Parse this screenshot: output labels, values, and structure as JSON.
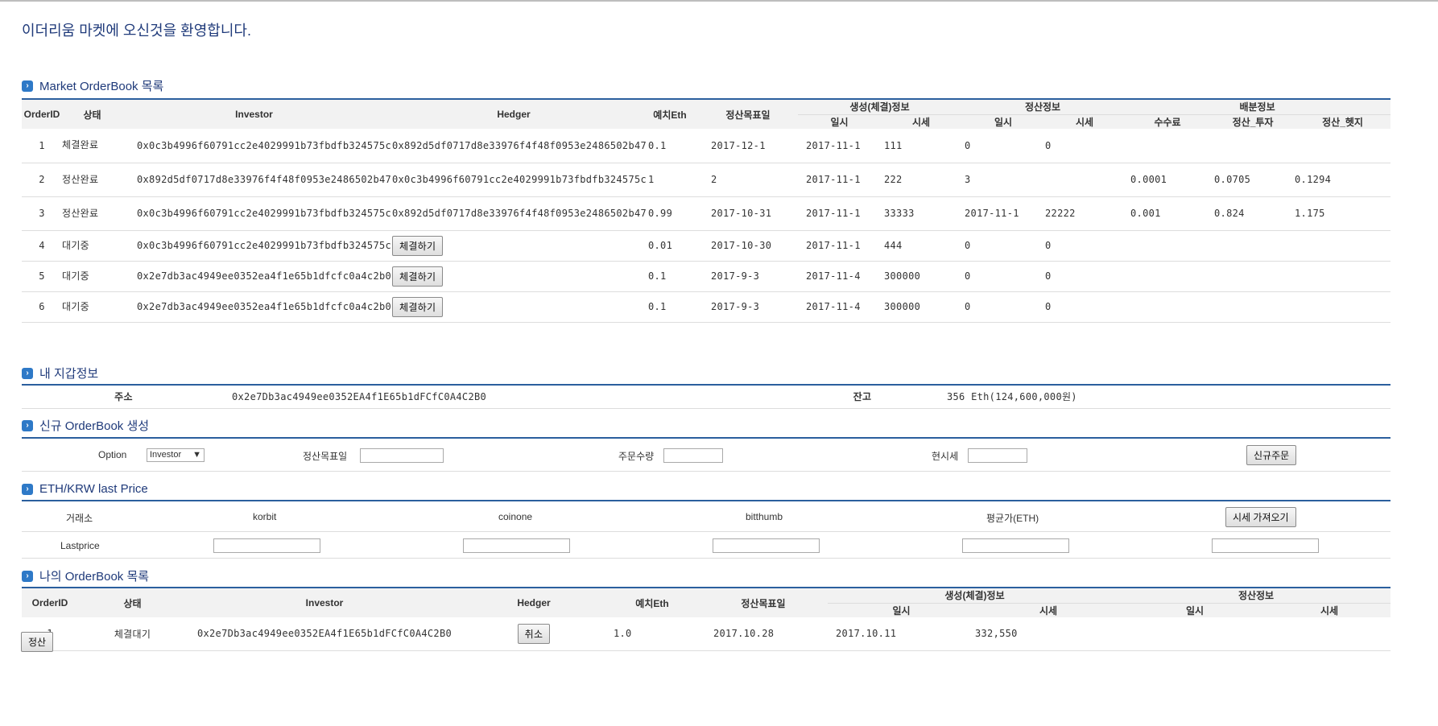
{
  "welcome": "이더리움 마켓에 오신것을 환영합니다.",
  "market": {
    "title": "Market OrderBook 목록",
    "headers": {
      "orderid": "OrderID",
      "status": "상태",
      "investor": "Investor",
      "hedger": "Hedger",
      "deposit": "예치Eth",
      "target": "정산목표일",
      "group_create": "생성(체결)정보",
      "group_settle": "정산정보",
      "group_dist": "배분정보",
      "date": "일시",
      "price": "시세",
      "fee": "수수료",
      "settle_invest": "정산_투자",
      "settle_hedge": "정산_헷지"
    },
    "rows": [
      {
        "id": "1",
        "status": "체결완료",
        "investor": "0x0c3b4996f60791cc2e4029991b73fbdfb324575c",
        "hedger": "0x892d5df0717d8e33976f4f48f0953e2486502b47",
        "deposit": "0.1",
        "target": "2017-12-1",
        "cdate": "2017-11-1",
        "cprice": "111",
        "sdate": "0",
        "sprice": "0",
        "fee": "",
        "sinv": "",
        "shed": ""
      },
      {
        "id": "2",
        "status": "정산완료",
        "investor": "0x892d5df0717d8e33976f4f48f0953e2486502b47",
        "hedger": "0x0c3b4996f60791cc2e4029991b73fbdfb324575c",
        "deposit": "1",
        "target": "2",
        "cdate": "2017-11-1",
        "cprice": "222",
        "sdate": "3",
        "sprice": "",
        "fee": "0.0001",
        "sinv": "0.0705",
        "shed": "0.1294"
      },
      {
        "id": "3",
        "status": "정산완료",
        "investor": "0x0c3b4996f60791cc2e4029991b73fbdfb324575c",
        "hedger": "0x892d5df0717d8e33976f4f48f0953e2486502b47",
        "deposit": "0.99",
        "target": "2017-10-31",
        "cdate": "2017-11-1",
        "cprice": "33333",
        "sdate": "2017-11-1",
        "sprice": "22222",
        "fee": "0.001",
        "sinv": "0.824",
        "shed": "1.175"
      },
      {
        "id": "4",
        "status": "대기중",
        "investor": "0x0c3b4996f60791cc2e4029991b73fbdfb324575c",
        "hedger_button": "체결하기",
        "deposit": "0.01",
        "target": "2017-10-30",
        "cdate": "2017-11-1",
        "cprice": "444",
        "sdate": "0",
        "sprice": "0",
        "fee": "",
        "sinv": "",
        "shed": ""
      },
      {
        "id": "5",
        "status": "대기중",
        "investor": "0x2e7db3ac4949ee0352ea4f1e65b1dfcfc0a4c2b0",
        "hedger_button": "체결하기",
        "deposit": "0.1",
        "target": "2017-9-3",
        "cdate": "2017-11-4",
        "cprice": "300000",
        "sdate": "0",
        "sprice": "0",
        "fee": "",
        "sinv": "",
        "shed": ""
      },
      {
        "id": "6",
        "status": "대기중",
        "investor": "0x2e7db3ac4949ee0352ea4f1e65b1dfcfc0a4c2b0",
        "hedger_button": "체결하기",
        "deposit": "0.1",
        "target": "2017-9-3",
        "cdate": "2017-11-4",
        "cprice": "300000",
        "sdate": "0",
        "sprice": "0",
        "fee": "",
        "sinv": "",
        "shed": ""
      }
    ]
  },
  "wallet": {
    "title": "내 지갑정보",
    "address_label": "주소",
    "address": "0x2e7Db3ac4949ee0352EA4f1E65b1dFCfC0A4C2B0",
    "balance_label": "잔고",
    "balance": "356 Eth(124,600,000원)"
  },
  "new_order": {
    "title": "신규 OrderBook 생성",
    "option_label": "Option",
    "option_value": "Investor",
    "target_label": "정산목표일",
    "qty_label": "주문수량",
    "price_label": "현시세",
    "submit": "신규주문"
  },
  "price": {
    "title": "ETH/KRW last Price",
    "exchange_label": "거래소",
    "exchanges": [
      "korbit",
      "coinone",
      "bitthumb",
      "평균가(ETH)"
    ],
    "fetch_button": "시세 가져오기",
    "lastprice_label": "Lastprice"
  },
  "my_orders": {
    "title": "나의 OrderBook 목록",
    "headers": {
      "orderid": "OrderID",
      "status": "상태",
      "investor": "Investor",
      "hedger": "Hedger",
      "deposit": "예치Eth",
      "target": "정산목표일",
      "group_create": "생성(체결)정보",
      "group_settle": "정산정보",
      "date": "일시",
      "price": "시세"
    },
    "rows": [
      {
        "id": "1",
        "status": "체결대기",
        "investor": "0x2e7Db3ac4949ee0352EA4f1E65b1dFCfC0A4C2B0",
        "hedger_button": "취소",
        "deposit": "1.0",
        "target": "2017.10.28",
        "cdate": "2017.10.11",
        "cprice": "332,550",
        "sdate": "",
        "sprice": ""
      }
    ]
  },
  "settle_button": "정산"
}
